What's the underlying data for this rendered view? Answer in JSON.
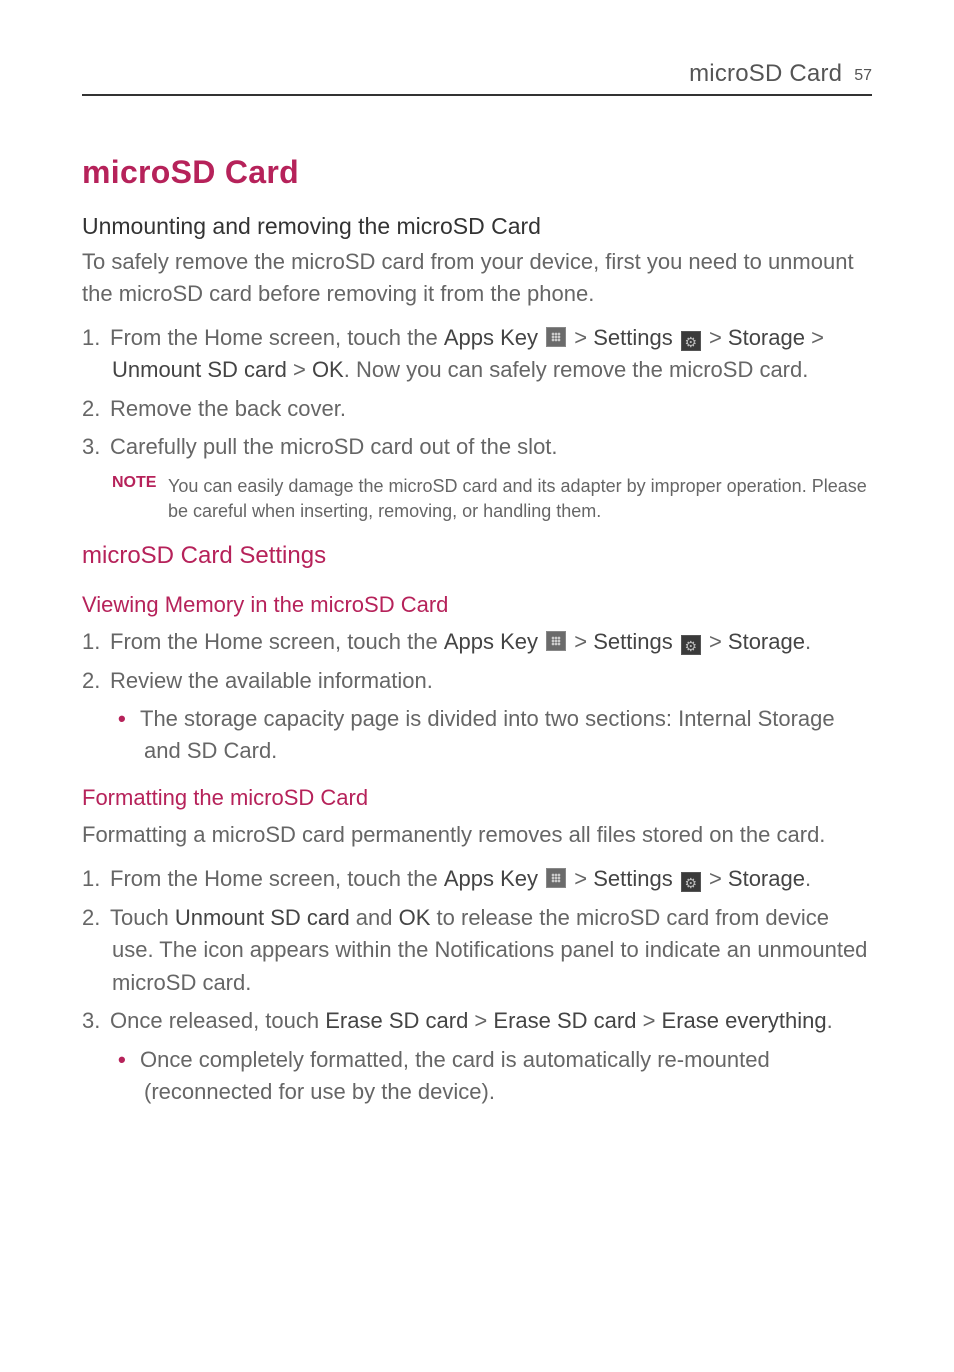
{
  "header": {
    "title": "microSD Card",
    "page_number": "57"
  },
  "title": "microSD Card",
  "section1": {
    "heading": "Unmounting and removing the microSD Card",
    "intro": "To safely remove the microSD card from your device, first you need to unmount the microSD card before removing it from the phone.",
    "steps": {
      "s1_num": "1. ",
      "s1_a": "From the Home screen, touch the ",
      "s1_b": "Apps Key",
      "s1_c": " > ",
      "s1_d": "Settings",
      "s1_e": " > ",
      "s1_f": "Storage",
      "s1_g": " > ",
      "s1_h": "Unmount SD card",
      "s1_i": " > ",
      "s1_j": "OK",
      "s1_k": ". Now you can safely remove the microSD card.",
      "s2_num": "2. ",
      "s2_text": "Remove the back cover.",
      "s3_num": "3. ",
      "s3_text": "Carefully pull the microSD card out of the slot."
    },
    "note": {
      "label": "NOTE",
      "text": "You can easily damage the microSD card and its adapter by improper operation. Please be careful when inserting, removing, or handling them."
    }
  },
  "section2": {
    "heading": "microSD Card Settings",
    "sub1": {
      "heading": "Viewing Memory in the microSD Card",
      "s1_num": "1. ",
      "s1_a": "From the Home screen, touch the ",
      "s1_b": "Apps Key",
      "s1_c": " > ",
      "s1_d": "Settings",
      "s1_e": " > ",
      "s1_f": "Storage",
      "s1_g": ".",
      "s2_num": "2. ",
      "s2_text": "Review the available information.",
      "bullet1": "The storage capacity page is divided into two sections: Internal Storage and SD Card."
    },
    "sub2": {
      "heading": "Formatting the microSD Card",
      "intro": "Formatting a microSD card permanently removes all files stored on the card.",
      "s1_num": "1. ",
      "s1_a": "From the Home screen, touch the ",
      "s1_b": "Apps Key",
      "s1_c": " > ",
      "s1_d": "Settings",
      "s1_e": " > ",
      "s1_f": "Storage",
      "s1_g": ".",
      "s2_num": "2. ",
      "s2_a": "Touch ",
      "s2_b": "Unmount SD card",
      "s2_c": " and ",
      "s2_d": "OK",
      "s2_e": " to release the microSD card from device use. The icon appears within the Notifications panel to indicate an unmounted microSD card.",
      "s3_num": "3. ",
      "s3_a": "Once released, touch ",
      "s3_b": "Erase SD card",
      "s3_c": " > ",
      "s3_d": "Erase SD card",
      "s3_e": " > ",
      "s3_f": "Erase everything",
      "s3_g": ".",
      "bullet1": "Once completely formatted, the card is automatically re-mounted (reconnected for use by the device)."
    }
  },
  "icons": {
    "gear_glyph": "⚙"
  }
}
